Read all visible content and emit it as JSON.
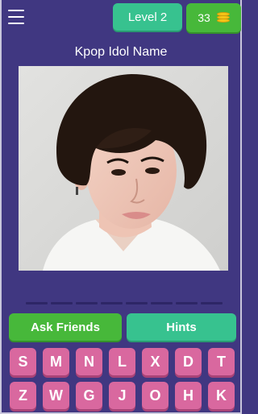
{
  "header": {
    "menu_icon": "hamburger-menu-icon",
    "level_label": "Level 2",
    "coins": "33",
    "coin_icon": "coin-stack-icon"
  },
  "quiz": {
    "title": "Kpop Idol Name",
    "answer_slot_count": 8
  },
  "actions": {
    "ask_friends_label": "Ask Friends",
    "hints_label": "Hints"
  },
  "letters": {
    "row1": [
      "S",
      "M",
      "N",
      "L",
      "X",
      "D",
      "T"
    ],
    "row2": [
      "Z",
      "W",
      "G",
      "J",
      "O",
      "H",
      "K"
    ]
  },
  "colors": {
    "background": "#403781",
    "level_badge": "#37c28f",
    "coin_badge": "#47b83a",
    "tile": "#d9689f"
  }
}
